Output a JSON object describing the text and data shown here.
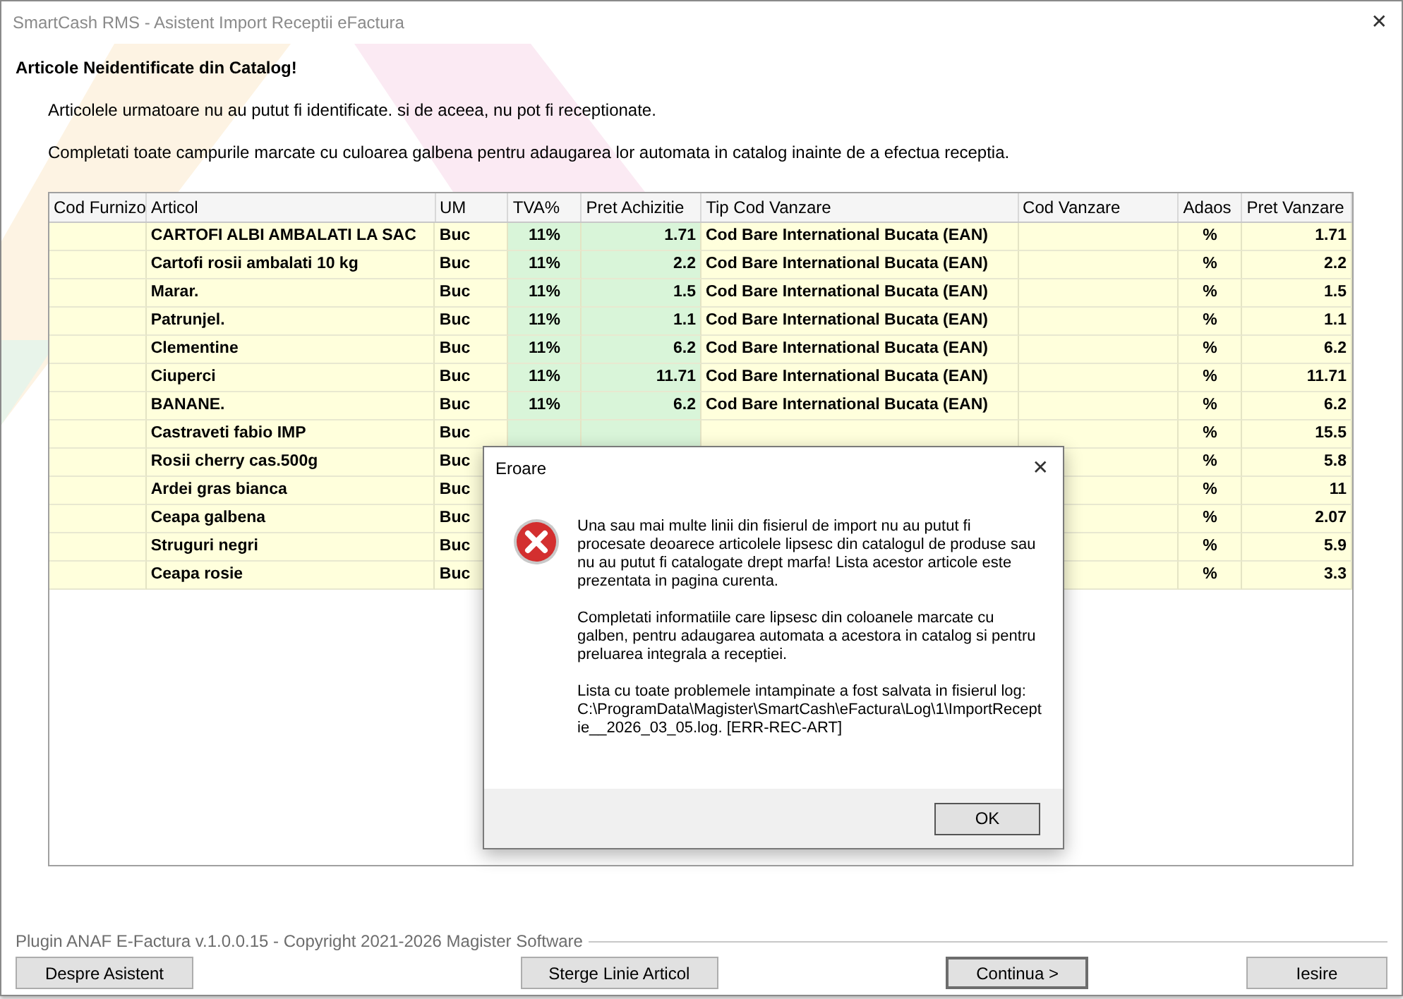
{
  "window": {
    "title": "SmartCash RMS - Asistent Import Receptii eFactura",
    "close": "✕"
  },
  "heading": "Articole Neidentificate din Catalog!",
  "intro": [
    "Articolele urmatoare nu au putut fi identificate. si de aceea, nu pot fi receptionate.",
    "Completati toate campurile marcate cu culoarea galbena pentru adaugarea lor automata in catalog inainte de a efectua receptia."
  ],
  "table": {
    "columns": [
      {
        "label": "Cod Furnizo",
        "color": "#ffffdc"
      },
      {
        "label": "Articol",
        "color": "#ffffdc"
      },
      {
        "label": "UM",
        "color": "#ffffdc"
      },
      {
        "label": "TVA%",
        "color": "#d9f5d9"
      },
      {
        "label": "Pret Achizitie",
        "color": "#d9f5d9"
      },
      {
        "label": "Tip Cod Vanzare",
        "color": "#ffffdc"
      },
      {
        "label": "Cod Vanzare",
        "color": "#ffffdc"
      },
      {
        "label": "Adaos",
        "color": "#ffffdc"
      },
      {
        "label": "Pret Vanzare",
        "color": "#ffffdc"
      }
    ],
    "rows": [
      {
        "cells": [
          null,
          "CARTOFI ALBI AMBALATI LA SAC",
          "Buc",
          "11%",
          "1.71",
          "Cod Bare International Bucata (EAN)",
          null,
          "%",
          "1.71"
        ]
      },
      {
        "cells": [
          null,
          "Cartofi rosii ambalati 10 kg",
          "Buc",
          "11%",
          "2.2",
          "Cod Bare International Bucata (EAN)",
          null,
          "%",
          "2.2"
        ]
      },
      {
        "cells": [
          null,
          "Marar.",
          "Buc",
          "11%",
          "1.5",
          "Cod Bare International Bucata (EAN)",
          null,
          "%",
          "1.5"
        ]
      },
      {
        "cells": [
          null,
          "Patrunjel.",
          "Buc",
          "11%",
          "1.1",
          "Cod Bare International Bucata (EAN)",
          null,
          "%",
          "1.1"
        ]
      },
      {
        "cells": [
          null,
          "Clementine",
          "Buc",
          "11%",
          "6.2",
          "Cod Bare International Bucata (EAN)",
          null,
          "%",
          "6.2"
        ]
      },
      {
        "cells": [
          null,
          "Ciuperci",
          "Buc",
          "11%",
          "11.71",
          "Cod Bare International Bucata (EAN)",
          null,
          "%",
          "11.71"
        ]
      },
      {
        "cells": [
          null,
          "BANANE.",
          "Buc",
          "11%",
          "6.2",
          "Cod Bare International Bucata (EAN)",
          null,
          "%",
          "6.2"
        ]
      },
      {
        "cells": [
          null,
          "Castraveti fabio IMP",
          "Buc",
          null,
          null,
          null,
          null,
          "%",
          "15.5"
        ]
      },
      {
        "cells": [
          null,
          "Rosii cherry cas.500g",
          "Buc",
          null,
          null,
          null,
          null,
          "%",
          "5.8"
        ]
      },
      {
        "cells": [
          null,
          "Ardei gras bianca",
          "Buc",
          null,
          null,
          null,
          null,
          "%",
          "11"
        ]
      },
      {
        "cells": [
          null,
          "Ceapa galbena",
          "Buc",
          null,
          null,
          null,
          null,
          "%",
          "2.07"
        ]
      },
      {
        "cells": [
          null,
          "Struguri negri",
          "Buc",
          null,
          null,
          null,
          null,
          "%",
          "5.9"
        ]
      },
      {
        "cells": [
          null,
          "Ceapa rosie",
          "Buc",
          null,
          null,
          null,
          null,
          "%",
          "3.3"
        ]
      }
    ]
  },
  "footer": {
    "version": "Plugin ANAF E-Factura v.1.0.0.15 - Copyright 2021-2026 Magister Software",
    "buttons": [
      {
        "label": "Despre Asistent",
        "default": false
      },
      {
        "label": "Sterge Linie Articol",
        "default": false
      },
      {
        "label": "Continua >",
        "default": true
      },
      {
        "label": "Iesire",
        "default": false
      }
    ]
  },
  "dialog": {
    "title": "Eroare",
    "close": "✕",
    "paragraphs": [
      "Una sau mai multe linii din fisierul de import nu au putut fi procesate deoarece articolele lipsesc din catalogul de produse sau nu au putut fi catalogate drept marfa! Lista acestor articole este prezentata in pagina curenta.",
      "Completati informatiile care lipsesc din coloanele marcate cu galben, pentru adaugarea automata a acestora in catalog si pentru preluarea integrala a receptiei.",
      "Lista cu toate problemele intampinate a fost salvata in fisierul log: C:\\ProgramData\\Magister\\SmartCash\\eFactura\\Log\\1\\ImportReceptie__2026_03_05.log. [ERR-REC-ART]"
    ],
    "button": "OK"
  }
}
